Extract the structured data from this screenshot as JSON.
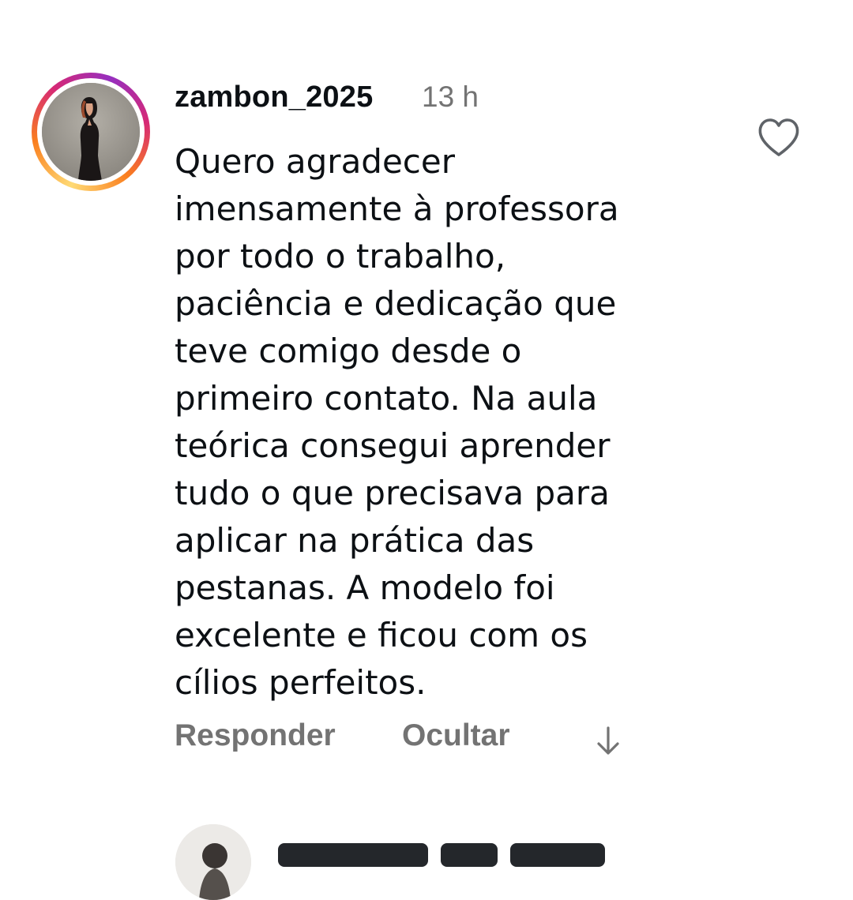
{
  "comment": {
    "username": "zambon_2025",
    "timestamp": "13 h",
    "text_lines": [
      "Quero agradecer",
      "imensamente à professora",
      "por todo o trabalho,",
      "paciência e dedicação que",
      "teve comigo desde o",
      "primeiro contato. Na aula",
      "teórica consegui aprender",
      "tudo o que precisava para",
      "aplicar na prática das",
      "pestanas. A modelo foi",
      "excelente e ficou com os",
      "cílios perfeitos."
    ],
    "actions": {
      "reply_label": "Responder",
      "hide_label": "Ocultar"
    },
    "icons": {
      "avatar": "profile-photo-woman-black-dress",
      "like": "heart-outline-icon",
      "translate": "arrow-down-icon"
    }
  },
  "colors": {
    "text_primary": "#0c1014",
    "text_secondary": "#737373",
    "story_ring": [
      "#feda75",
      "#fa7e1e",
      "#d62976",
      "#962fbf"
    ],
    "background": "#ffffff"
  }
}
